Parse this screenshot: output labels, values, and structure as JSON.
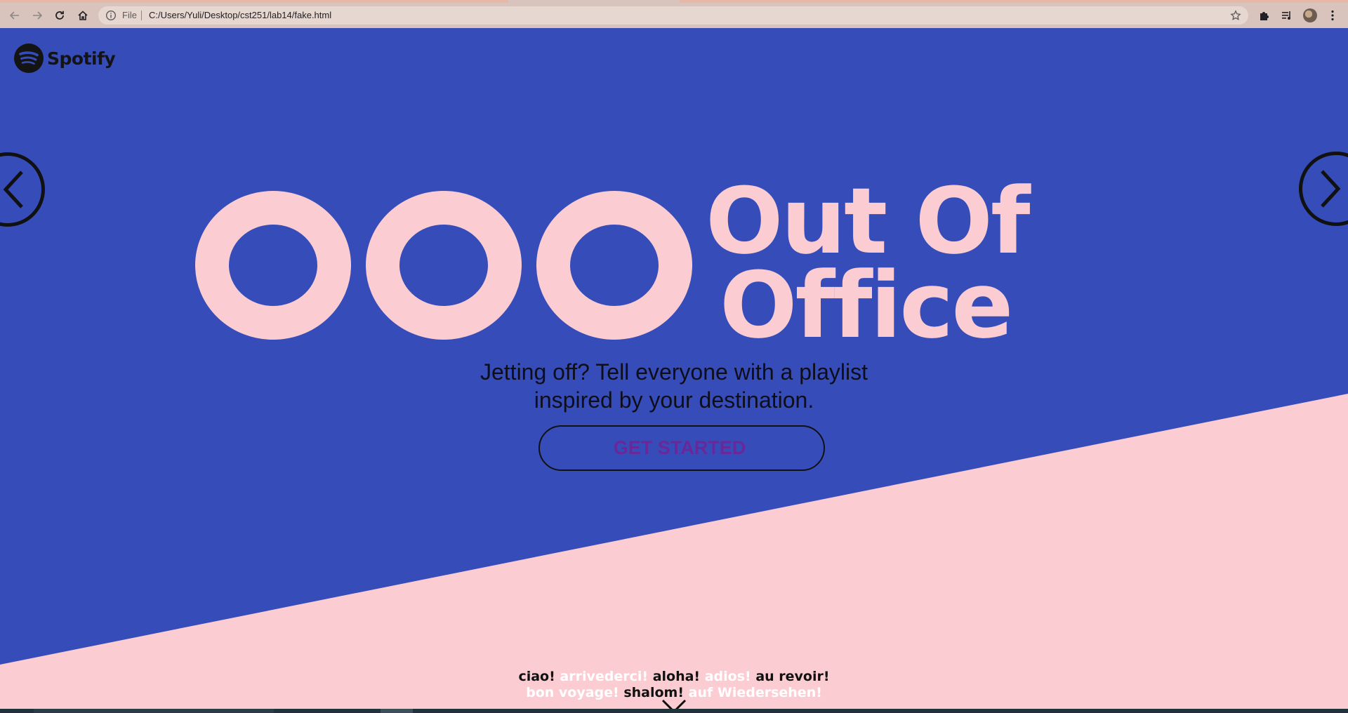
{
  "browser": {
    "scheme_label": "File",
    "url": "C:/Users/Yuli/Desktop/cst251/lab14/fake.html"
  },
  "page": {
    "logo_text": "Spotify",
    "hero": {
      "title_line1": "Out Of",
      "title_line2": "Office",
      "ooo_letters": [
        "O",
        "O",
        "O"
      ]
    },
    "subtitle_line1": "Jetting off? Tell everyone with a playlist",
    "subtitle_line2": "inspired by your destination.",
    "cta_label": "GET STARTED",
    "greetings": [
      {
        "text": "ciao!",
        "tone": "dark"
      },
      {
        "text": "arrivederci!",
        "tone": "light"
      },
      {
        "text": "aloha!",
        "tone": "dark"
      },
      {
        "text": "adios!",
        "tone": "light"
      },
      {
        "text": "au revoir!",
        "tone": "dark"
      },
      {
        "text": "bon voyage!",
        "tone": "light"
      },
      {
        "text": "shalom!",
        "tone": "dark"
      },
      {
        "text": "auf Wiedersehen!",
        "tone": "light"
      }
    ]
  },
  "colors": {
    "blue": "#364db9",
    "pink": "#fbcdd3",
    "cta_text": "#6b2799",
    "chrome": "#d8c4bc"
  },
  "icons": {
    "back": "arrow-left-icon",
    "forward": "arrow-right-icon",
    "reload": "reload-icon",
    "home": "home-icon",
    "info": "info-icon",
    "bookmark": "star-icon",
    "extensions": "puzzle-icon",
    "media": "playlist-icon",
    "menu": "kebab-menu-icon",
    "carousel_prev": "chevron-left-icon",
    "carousel_next": "chevron-right-icon",
    "scroll_down": "chevron-down-icon"
  }
}
